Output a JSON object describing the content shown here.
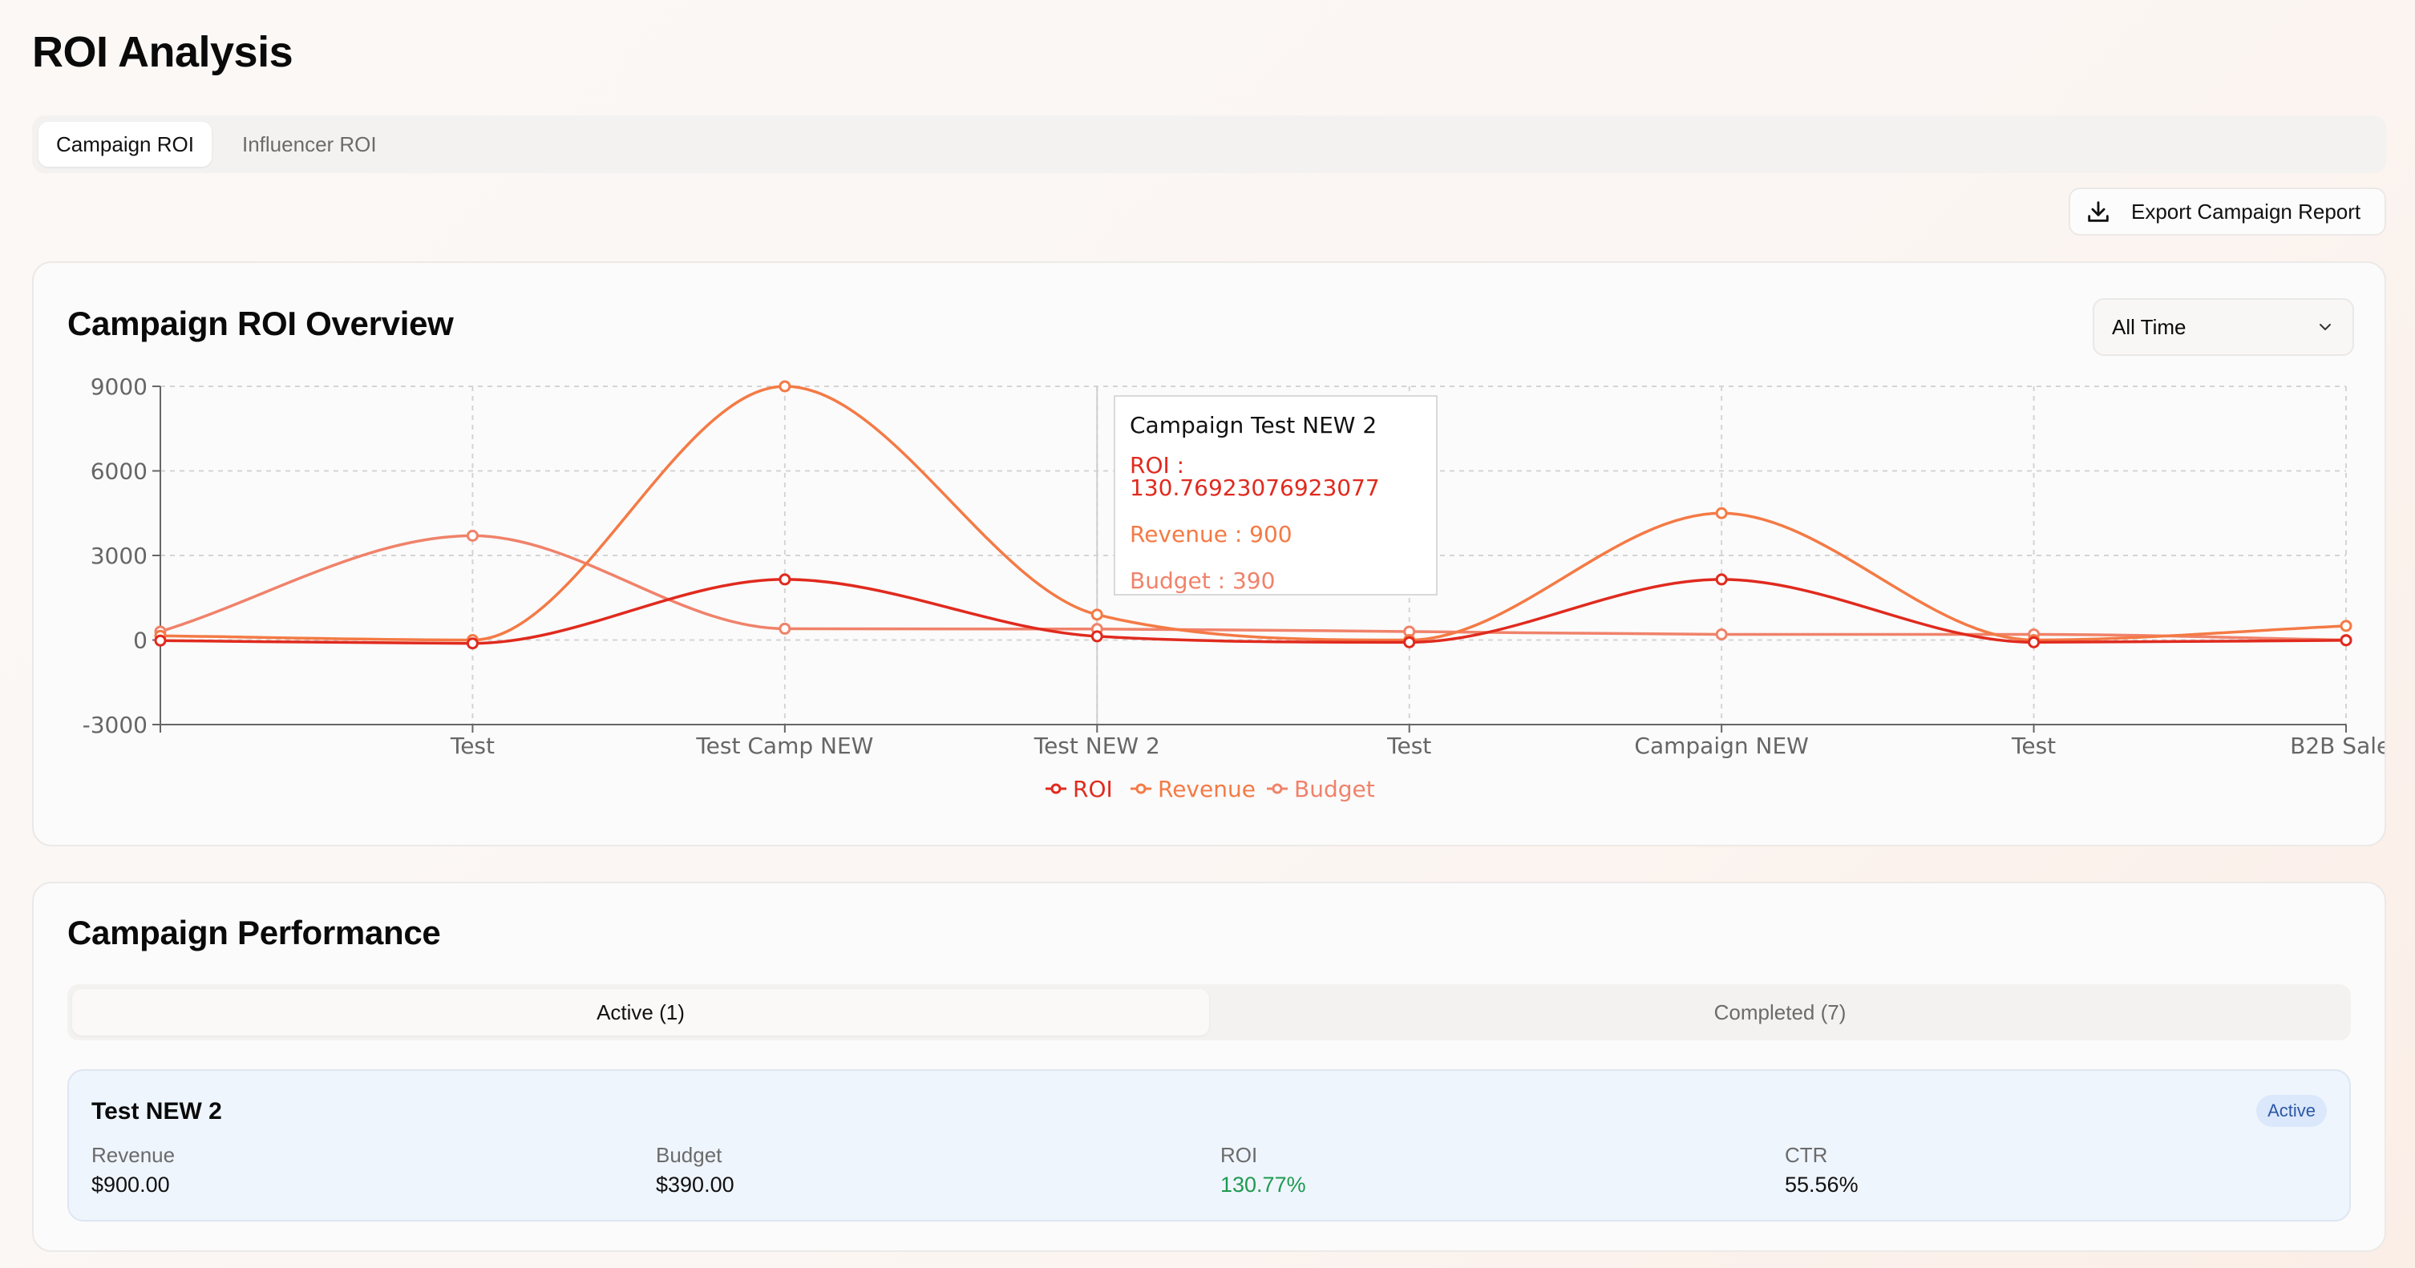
{
  "page": {
    "title": "ROI Analysis"
  },
  "tabs": [
    {
      "label": "Campaign ROI",
      "active": true
    },
    {
      "label": "Influencer ROI",
      "active": false
    }
  ],
  "export_button": {
    "label": "Export Campaign Report",
    "icon": "download-icon"
  },
  "overview": {
    "title": "Campaign ROI Overview",
    "period_select": {
      "value": "All Time"
    }
  },
  "chart_data": {
    "type": "line",
    "categories": [
      "",
      "Test",
      "Test Camp NEW",
      "Test NEW 2",
      "Test",
      "Campaign NEW",
      "Test",
      "B2B Sales"
    ],
    "ylim": [
      -3000,
      9000
    ],
    "yticks": [
      -3000,
      0,
      3000,
      6000,
      9000
    ],
    "grid": true,
    "legend": "bottom",
    "series": [
      {
        "name": "ROI",
        "color": "#e02a1e",
        "values": [
          -20,
          -120,
          2150,
          131,
          -80,
          2150,
          -80,
          -10
        ]
      },
      {
        "name": "Revenue",
        "color": "#f47a45",
        "values": [
          150,
          0,
          9000,
          900,
          0,
          4500,
          0,
          500
        ]
      },
      {
        "name": "Budget",
        "color": "#f0826a",
        "values": [
          300,
          3700,
          400,
          390,
          300,
          200,
          200,
          0
        ]
      }
    ]
  },
  "tooltip": {
    "title": "Campaign Test NEW 2",
    "roi": "ROI : 130.76923076923077",
    "revenue": "Revenue : 900",
    "budget": "Budget : 390"
  },
  "performance": {
    "title": "Campaign Performance",
    "status_tabs": [
      {
        "label": "Active (1)",
        "active": true
      },
      {
        "label": "Completed (7)",
        "active": false
      }
    ],
    "campaign": {
      "name": "Test NEW 2",
      "status": "Active",
      "metrics": [
        {
          "label": "Revenue",
          "value": "$900.00"
        },
        {
          "label": "Budget",
          "value": "$390.00"
        },
        {
          "label": "ROI",
          "value": "130.77%"
        },
        {
          "label": "CTR",
          "value": "55.56%"
        }
      ]
    }
  }
}
